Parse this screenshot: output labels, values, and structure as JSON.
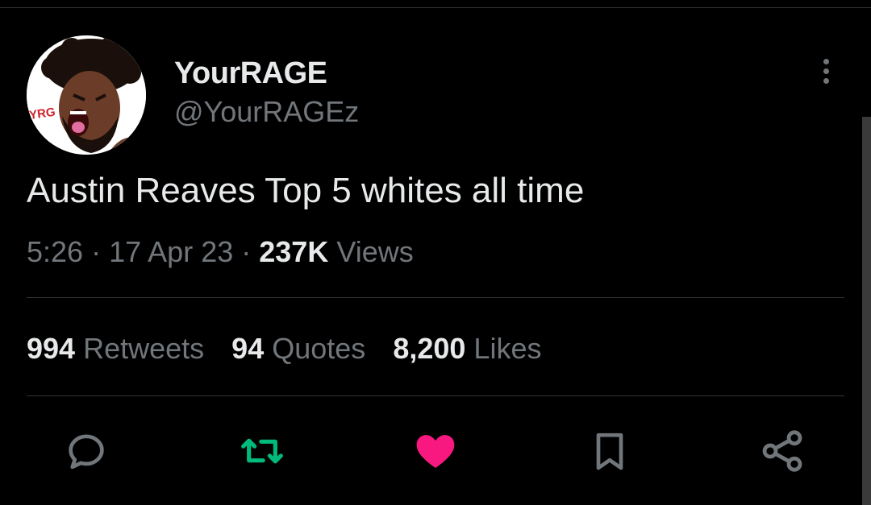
{
  "author": {
    "display_name": "YourRAGE",
    "handle": "@YourRAGEz",
    "avatar_label": "YRG"
  },
  "tweet": {
    "text": "Austin Reaves Top 5 whites all time"
  },
  "meta": {
    "time": "5:26",
    "date": "17 Apr 23",
    "separator": "·",
    "views_count": "237K",
    "views_label": "Views"
  },
  "stats": {
    "retweets_count": "994",
    "retweets_label": "Retweets",
    "quotes_count": "94",
    "quotes_label": "Quotes",
    "likes_count": "8,200",
    "likes_label": "Likes"
  },
  "icons": {
    "more": "more-vertical-icon",
    "reply": "reply-icon",
    "retweet": "retweet-icon",
    "like": "heart-icon",
    "bookmark": "bookmark-icon",
    "share": "share-icon"
  },
  "colors": {
    "background": "#000000",
    "text_primary": "#e7e9ea",
    "text_secondary": "#71767b",
    "retweet_active": "#00ba7c",
    "like_active": "#f91880"
  }
}
